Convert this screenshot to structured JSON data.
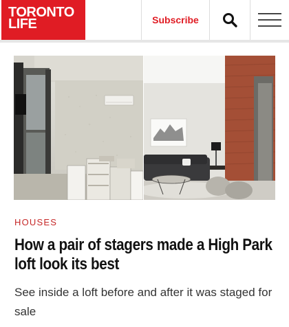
{
  "header": {
    "logo_line1": "TORONTO",
    "logo_line2": "LIFE",
    "subscribe_label": "Subscribe",
    "search_icon": "search-icon",
    "menu_icon": "hamburger-menu-icon"
  },
  "article": {
    "category": "HOUSES",
    "headline": "How a pair of stagers made a High Park loft look its best",
    "dek": "See inside a loft before and after it was staged for sale"
  },
  "colors": {
    "brand_red": "#e01c24",
    "category_red": "#c62828",
    "headline": "#111111",
    "dek": "#333333"
  }
}
